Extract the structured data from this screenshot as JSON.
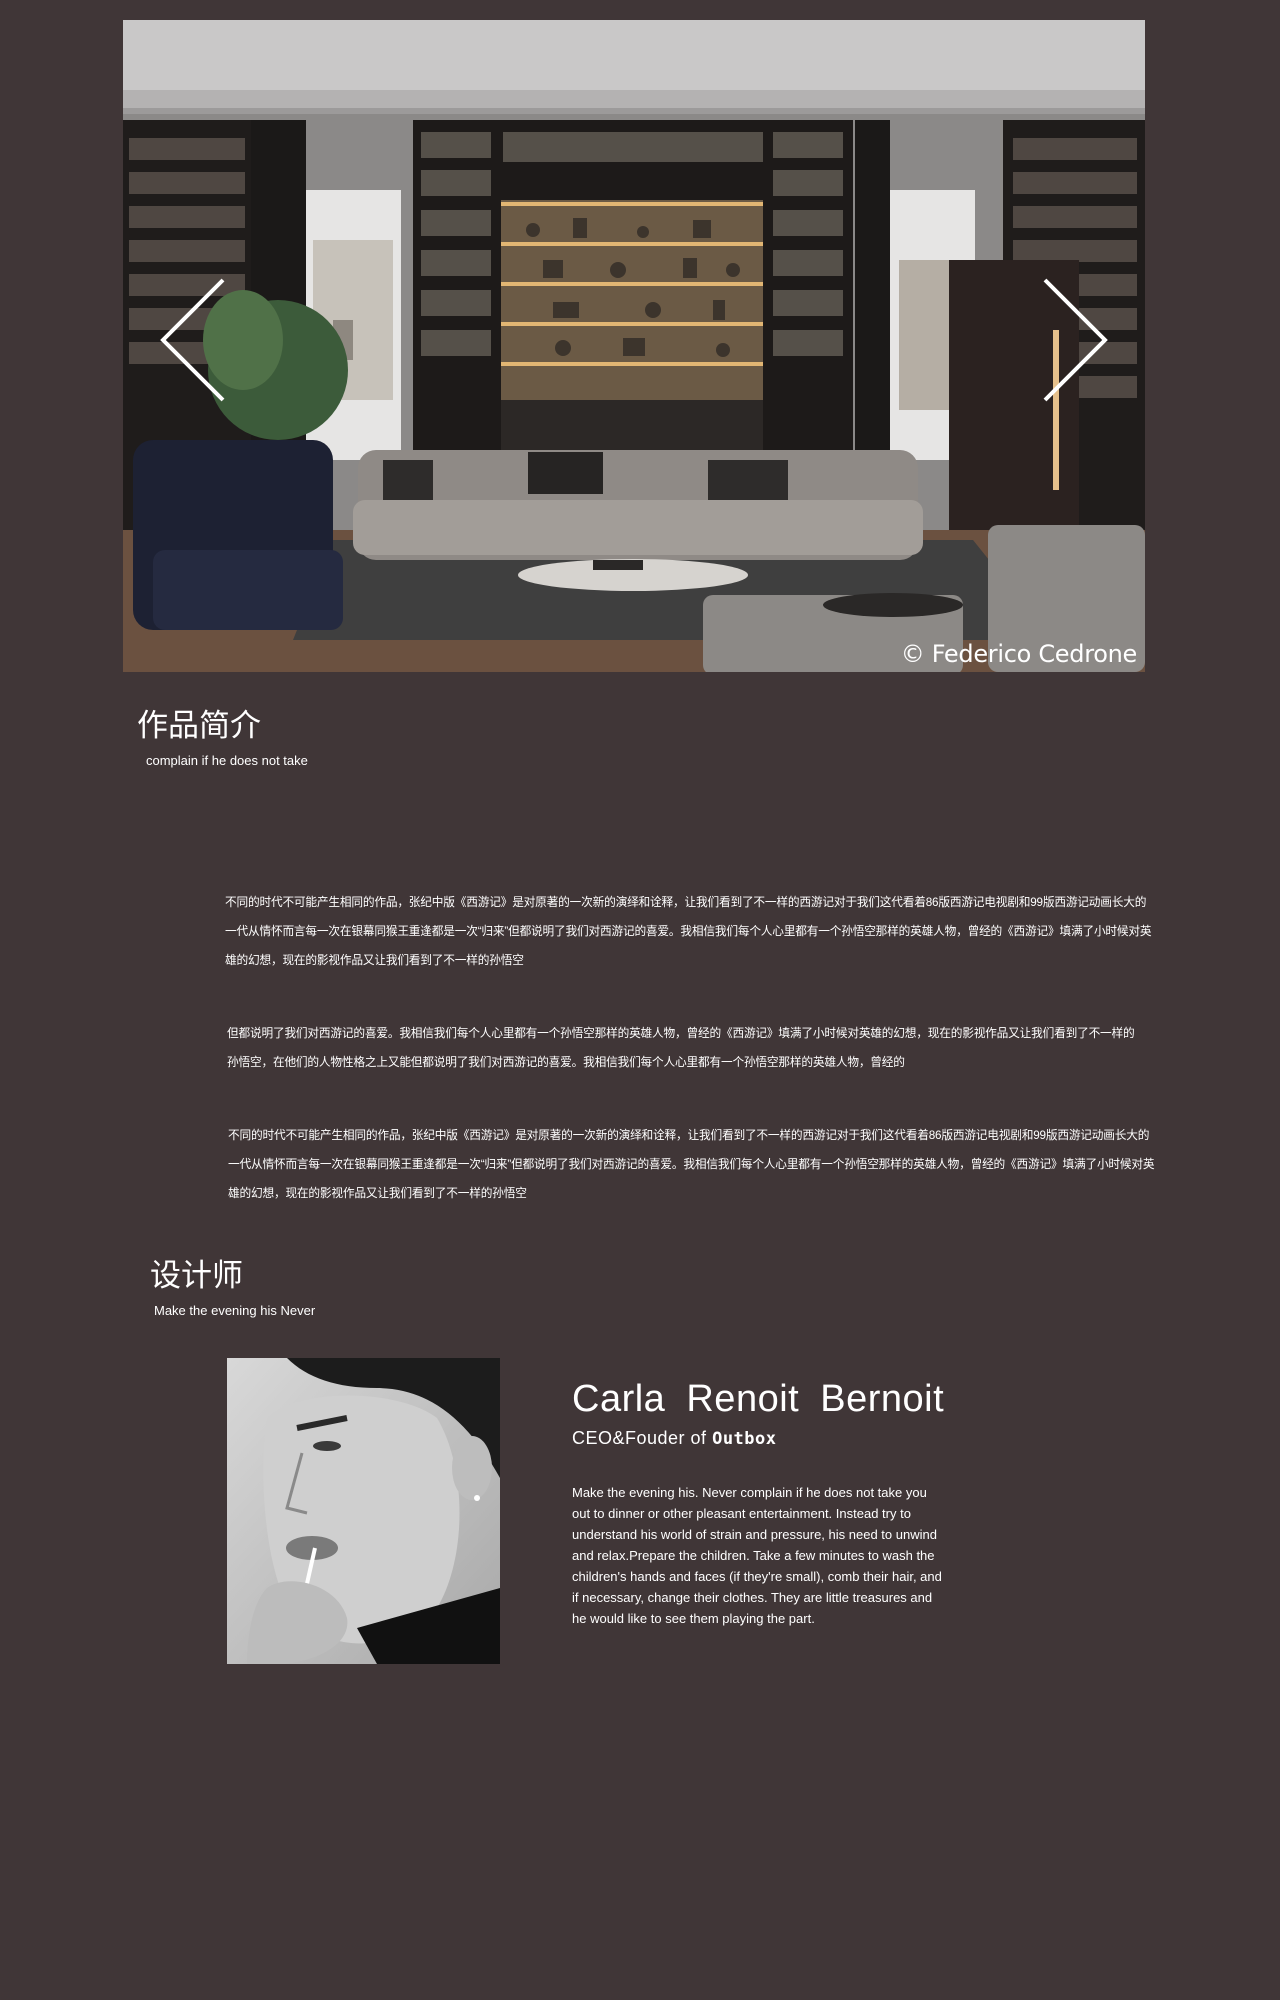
{
  "hero": {
    "credit": "© Federico Cedrone",
    "prev_icon": "chevron-left-icon",
    "next_icon": "chevron-right-icon"
  },
  "intro": {
    "title": "作品简介",
    "subtitle": "complain if he does not take",
    "paragraphs": [
      "不同的时代不可能产生相同的作品，张纪中版《西游记》是对原著的一次新的演绎和诠释，让我们看到了不一样的西游记对于我们这代看着86版西游记电视剧和99版西游记动画长大的一代从情怀而言每一次在银幕同猴王重逢都是一次“归来”但都说明了我们对西游记的喜爱。我相信我们每个人心里都有一个孙悟空那样的英雄人物，曾经的《西游记》填满了小时候对英雄的幻想，现在的影视作品又让我们看到了不一样的孙悟空",
      "但都说明了我们对西游记的喜爱。我相信我们每个人心里都有一个孙悟空那样的英雄人物，曾经的《西游记》填满了小时候对英雄的幻想，现在的影视作品又让我们看到了不一样的孙悟空，在他们的人物性格之上又能但都说明了我们对西游记的喜爱。我相信我们每个人心里都有一个孙悟空那样的英雄人物，曾经的",
      "不同的时代不可能产生相同的作品，张纪中版《西游记》是对原著的一次新的演绎和诠释，让我们看到了不一样的西游记对于我们这代看着86版西游记电视剧和99版西游记动画长大的一代从情怀而言每一次在银幕同猴王重逢都是一次“归来”但都说明了我们对西游记的喜爱。我相信我们每个人心里都有一个孙悟空那样的英雄人物，曾经的《西游记》填满了小时候对英雄的幻想，现在的影视作品又让我们看到了不一样的孙悟空"
    ]
  },
  "designer": {
    "section_title": "设计师",
    "section_subtitle": "Make the evening his Never",
    "name": "Carla  Renoit  Bernoit",
    "role_prefix": "CEO&Fouder of",
    "company": "Outbox",
    "bio": "Make the evening his. Never complain if he does not take you out to dinner or other pleasant entertainment. Instead try to understand his world of strain and pressure, his need to unwind and relax.Prepare the children. Take a few minutes to wash the children's hands and faces (if they're small), comb their hair, and if necessary, change their clothes. They are little treasures and he would like to see them playing the part."
  }
}
